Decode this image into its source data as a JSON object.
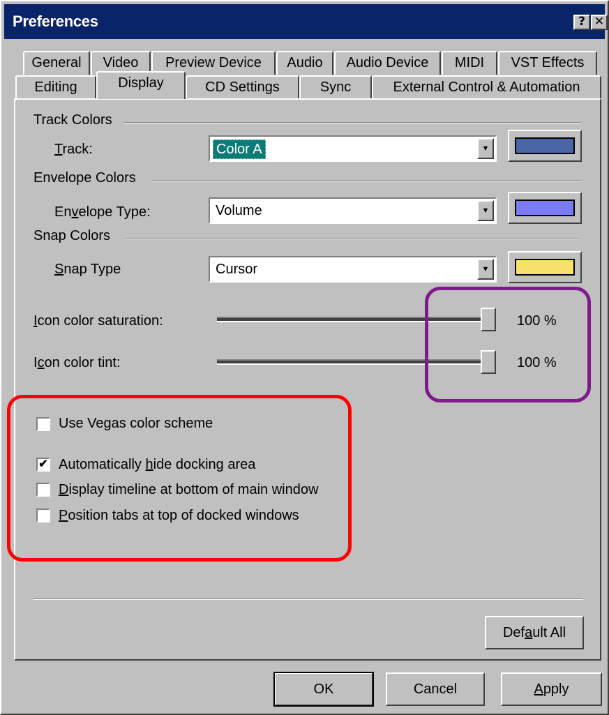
{
  "window": {
    "title": "Preferences",
    "help_glyph": "?",
    "close_glyph": "✕"
  },
  "tabs": {
    "row1": [
      "General",
      "Video",
      "Preview Device",
      "Audio",
      "Audio Device",
      "MIDI",
      "VST Effects"
    ],
    "row2": [
      "Editing",
      "Display",
      "CD Settings",
      "Sync",
      "External Control & Automation"
    ],
    "active": "Display"
  },
  "track_colors": {
    "group": "Track Colors",
    "label": "Track:",
    "value": "Color A",
    "swatch": "#4a66a8"
  },
  "envelope_colors": {
    "group": "Envelope Colors",
    "label": "Envelope Type:",
    "value": "Volume",
    "swatch": "#7b7bf5"
  },
  "snap_colors": {
    "group": "Snap Colors",
    "label": "Snap Type",
    "value": "Cursor",
    "swatch": "#f5e26b"
  },
  "sliders": {
    "saturation": {
      "label": "Icon color saturation:",
      "value_text": "100 %",
      "value": 100
    },
    "tint": {
      "label": "Icon color tint:",
      "value_text": "100 %",
      "value": 100
    }
  },
  "checkboxes": [
    {
      "label": "Use Vegas color scheme",
      "checked": false
    },
    {
      "label": "Automatically hide docking area",
      "checked": true
    },
    {
      "label": "Display timeline at bottom of main window",
      "checked": false
    },
    {
      "label": "Position tabs at top of docked windows",
      "checked": false
    }
  ],
  "buttons": {
    "default_all": "Default All",
    "ok": "OK",
    "cancel": "Cancel",
    "apply": "Apply"
  },
  "annotations": {
    "red_color": "#ff0000",
    "purple_color": "#7f1a8c"
  }
}
